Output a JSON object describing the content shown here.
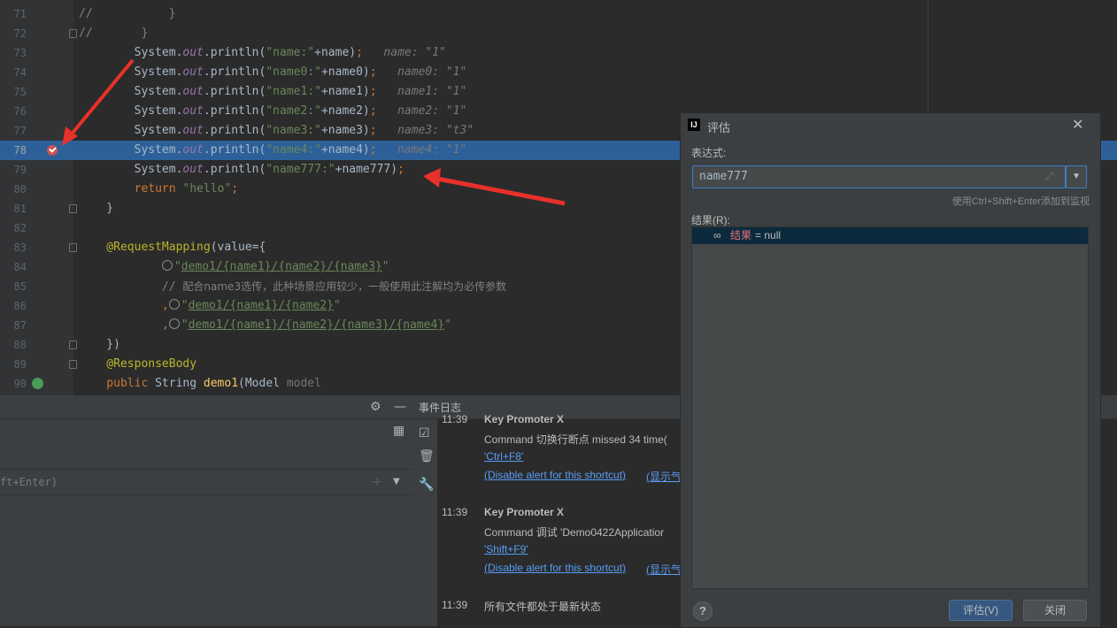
{
  "editor": {
    "lines": [
      {
        "n": "71",
        "tokens": [
          {
            "c": "com",
            "t": "//           }"
          }
        ]
      },
      {
        "n": "72",
        "tokens": [
          {
            "c": "com",
            "t": "//       }"
          }
        ]
      },
      {
        "n": "73",
        "tokens": [
          {
            "t": "        System."
          },
          {
            "c": "fld",
            "t": "out"
          },
          {
            "t": ".println("
          },
          {
            "c": "str",
            "t": "\"name:\""
          },
          {
            "t": "+name)"
          },
          {
            "c": "kw",
            "t": ";"
          },
          {
            "c": "hint",
            "t": "   name: \"1\""
          }
        ]
      },
      {
        "n": "74",
        "tokens": [
          {
            "t": "        System."
          },
          {
            "c": "fld",
            "t": "out"
          },
          {
            "t": ".println("
          },
          {
            "c": "str",
            "t": "\"name0:\""
          },
          {
            "t": "+name0)"
          },
          {
            "c": "kw",
            "t": ";"
          },
          {
            "c": "hint",
            "t": "   name0: \"1\""
          }
        ]
      },
      {
        "n": "75",
        "tokens": [
          {
            "t": "        System."
          },
          {
            "c": "fld",
            "t": "out"
          },
          {
            "t": ".println("
          },
          {
            "c": "str",
            "t": "\"name1:\""
          },
          {
            "t": "+name1)"
          },
          {
            "c": "kw",
            "t": ";"
          },
          {
            "c": "hint",
            "t": "   name1: \"1\""
          }
        ]
      },
      {
        "n": "76",
        "tokens": [
          {
            "t": "        System."
          },
          {
            "c": "fld",
            "t": "out"
          },
          {
            "t": ".println("
          },
          {
            "c": "str",
            "t": "\"name2:\""
          },
          {
            "t": "+name2)"
          },
          {
            "c": "kw",
            "t": ";"
          },
          {
            "c": "hint",
            "t": "   name2: \"1\""
          }
        ]
      },
      {
        "n": "77",
        "tokens": [
          {
            "t": "        System."
          },
          {
            "c": "fld",
            "t": "out"
          },
          {
            "t": ".println("
          },
          {
            "c": "str",
            "t": "\"name3:\""
          },
          {
            "t": "+name3)"
          },
          {
            "c": "kw",
            "t": ";"
          },
          {
            "c": "hint",
            "t": "   name3: \"t3\""
          }
        ]
      },
      {
        "n": "78",
        "tokens": [
          {
            "t": "        System."
          },
          {
            "c": "fld",
            "t": "out"
          },
          {
            "t": ".println("
          },
          {
            "c": "str",
            "t": "\"name4:\""
          },
          {
            "t": "+name4)"
          },
          {
            "c": "kw",
            "t": ";"
          },
          {
            "c": "hint",
            "t": "   name4: \"1\""
          }
        ]
      },
      {
        "n": "79",
        "tokens": [
          {
            "t": "        System."
          },
          {
            "c": "fld",
            "t": "out"
          },
          {
            "t": ".println("
          },
          {
            "c": "str",
            "t": "\"name777:\""
          },
          {
            "t": "+name777)"
          },
          {
            "c": "kw",
            "t": ";"
          }
        ]
      },
      {
        "n": "80",
        "tokens": [
          {
            "c": "kw",
            "t": "        return "
          },
          {
            "c": "str",
            "t": "\"hello\""
          },
          {
            "c": "kw",
            "t": ";"
          }
        ]
      },
      {
        "n": "81",
        "tokens": [
          {
            "t": "    }"
          }
        ]
      },
      {
        "n": "82",
        "tokens": []
      },
      {
        "n": "83",
        "tokens": [
          {
            "c": "ann",
            "t": "    @RequestMapping"
          },
          {
            "t": "(value={"
          }
        ]
      },
      {
        "n": "84",
        "tokens": [
          {
            "t": "            "
          },
          {
            "c": "glob",
            "t": ""
          },
          {
            "c": "str",
            "t": "\""
          },
          {
            "c": "url",
            "t": "demo1/{name1}/{name2}/{name3}"
          },
          {
            "c": "str",
            "t": "\""
          }
        ]
      },
      {
        "n": "85",
        "tokens": [
          {
            "t": "            "
          },
          {
            "c": "com",
            "t": "// "
          },
          {
            "c": "cm",
            "t": "配合name3选传，此种场景应用较少，一般使用此注解均为必传参数"
          }
        ]
      },
      {
        "n": "86",
        "tokens": [
          {
            "t": "            "
          },
          {
            "c": "kw",
            "t": ","
          },
          {
            "c": "glob",
            "t": ""
          },
          {
            "c": "str",
            "t": "\""
          },
          {
            "c": "url",
            "t": "demo1/{name1}/{name2}"
          },
          {
            "c": "str",
            "t": "\""
          }
        ]
      },
      {
        "n": "87",
        "tokens": [
          {
            "t": "            "
          },
          {
            "c": "kw",
            "t": ","
          },
          {
            "c": "glob",
            "t": ""
          },
          {
            "c": "str",
            "t": "\""
          },
          {
            "c": "url",
            "t": "demo1/{name1}/{name2}/{name3}/{name4}"
          },
          {
            "c": "str",
            "t": "\""
          }
        ]
      },
      {
        "n": "88",
        "tokens": [
          {
            "t": "    })"
          }
        ]
      },
      {
        "n": "89",
        "tokens": [
          {
            "c": "ann",
            "t": "    @ResponseBody"
          }
        ]
      },
      {
        "n": "90",
        "tokens": [
          {
            "c": "kw",
            "t": "    public "
          },
          {
            "t": "String "
          },
          {
            "c": "fn",
            "t": "demo1"
          },
          {
            "t": "(Model "
          },
          {
            "c": "par",
            "t": "model"
          }
        ]
      }
    ]
  },
  "watches": {
    "input_placeholder": "ft+Enter)"
  },
  "event_log": {
    "title": "事件日志",
    "entries": [
      {
        "time": "11:39",
        "title": "Key Promoter X",
        "text": "Command 切换行断点 missed 34 time(",
        "link1": "'Ctrl+F8'",
        "link2": "(Disable alert for this shortcut)",
        "link3": "(显示气"
      },
      {
        "time": "11:39",
        "title": "Key Promoter X",
        "text": "Command 调试 'Demo0422Applicatior",
        "link1": "'Shift+F9'",
        "link2": "(Disable alert for this shortcut)",
        "link3": "(显示气"
      },
      {
        "time": "11:39",
        "text": "所有文件都处于最新状态"
      }
    ]
  },
  "dialog": {
    "title": "评估",
    "expression_label": "表达式:",
    "expression_value": "name777",
    "hint": "使用Ctrl+Shift+Enter添加到监视",
    "result_label": "结果(R):",
    "result_name": "结果",
    "result_value": "= null",
    "help_label": "?",
    "evaluate_label": "评估(V)",
    "close_label": "关闭"
  }
}
